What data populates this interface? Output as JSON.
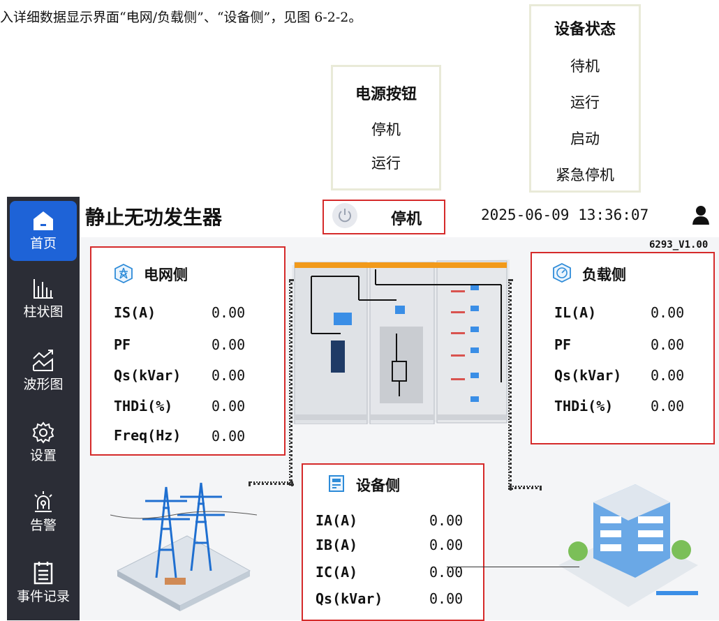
{
  "doc": {
    "intro_line": "入详细数据显示界面“电网/负载侧”、“设备侧”，见图 6-2-2。"
  },
  "callouts": {
    "power_button": {
      "title": "电源按钮",
      "items": [
        "停机",
        "运行"
      ]
    },
    "device_status": {
      "title": "设备状态",
      "items": [
        "待机",
        "运行",
        "启动",
        "紧急停机"
      ]
    }
  },
  "sidebar": {
    "items": [
      {
        "label": "首页",
        "icon": "home-icon",
        "active": true
      },
      {
        "label": "柱状图",
        "icon": "bar-chart-icon"
      },
      {
        "label": "波形图",
        "icon": "waveform-icon"
      },
      {
        "label": "设置",
        "icon": "gear-icon"
      },
      {
        "label": "告警",
        "icon": "alarm-icon"
      },
      {
        "label": "事件记录",
        "icon": "event-log-icon"
      }
    ]
  },
  "header": {
    "title": "静止无功发生器",
    "power_state": "停机",
    "datetime": "2025-06-09 13:36:07",
    "version": "6293_V1.00"
  },
  "grid_panel": {
    "title": "电网侧",
    "rows": [
      {
        "label": "IS(A)",
        "value": "0.00"
      },
      {
        "label": "PF",
        "value": "0.00"
      },
      {
        "label": "Qs(kVar)",
        "value": "0.00"
      },
      {
        "label": "THDi(%)",
        "value": "0.00"
      },
      {
        "label": "Freq(Hz)",
        "value": "0.00"
      }
    ]
  },
  "load_panel": {
    "title": "负载侧",
    "rows": [
      {
        "label": "IL(A)",
        "value": "0.00"
      },
      {
        "label": "PF",
        "value": "0.00"
      },
      {
        "label": "Qs(kVar)",
        "value": "0.00"
      },
      {
        "label": "THDi(%)",
        "value": "0.00"
      }
    ]
  },
  "device_panel": {
    "title": "设备侧",
    "rows": [
      {
        "label": "IA(A)",
        "value": "0.00"
      },
      {
        "label": "IB(A)",
        "value": "0.00"
      },
      {
        "label": "IC(A)",
        "value": "0.00"
      },
      {
        "label": "Qs(kVar)",
        "value": "0.00"
      }
    ]
  },
  "colors": {
    "sidebar_bg": "#2b2d36",
    "active_nav": "#1e63d7",
    "highlight_border": "#d52a2a",
    "icon_blue": "#2d8bd8"
  }
}
